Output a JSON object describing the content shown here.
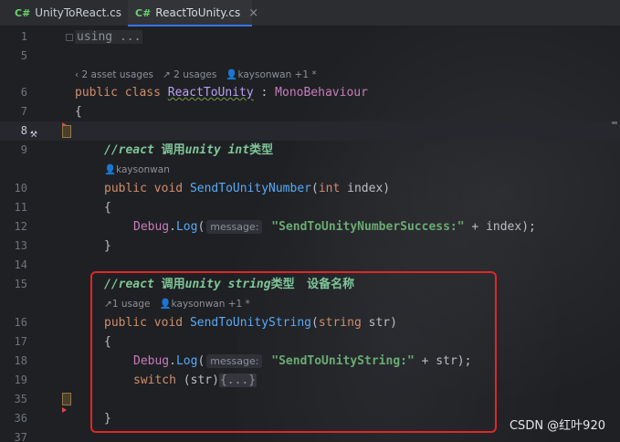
{
  "tabs": [
    {
      "badge": "C#",
      "label": "UnityToReact.cs"
    },
    {
      "badge": "C#",
      "label": "ReactToUnity.cs",
      "active": true
    }
  ],
  "tab_close": "×",
  "code": {
    "line1": {
      "num": "1",
      "fold": "using ..."
    },
    "line5": {
      "num": "5"
    },
    "hint_class": {
      "assets": "‹ 2 asset usages",
      "usages": "2 usages",
      "author": "kaysonwan +1 *"
    },
    "line6": {
      "num": "6",
      "kw1": "public",
      "kw2": "class",
      "name": "ReactToUnity",
      "colon": " : ",
      "base": "MonoBehaviour"
    },
    "line7": {
      "num": "7",
      "text": "{"
    },
    "line8": {
      "num": "8"
    },
    "line9": {
      "num": "9",
      "cmt_a": "//react ",
      "cmt_cn": "调用",
      "cmt_b": "unity int",
      "cmt_cn2": "类型"
    },
    "hint_m1": {
      "author": "kaysonwan"
    },
    "line10": {
      "num": "10",
      "kw1": "public",
      "kw2": "void",
      "name": "SendToUnityNumber",
      "open": "(",
      "ptype": "int",
      "rest": " index)"
    },
    "line11": {
      "num": "11",
      "text": "{"
    },
    "line12": {
      "num": "12",
      "cls": "Debug",
      "dot": ".",
      "call": "Log",
      "open": "(",
      "hint": "message:",
      "str": "\"SendToUnityNumberSuccess:\"",
      "rest": " + index);"
    },
    "line13": {
      "num": "13",
      "text": "}"
    },
    "line14": {
      "num": "14"
    },
    "line15": {
      "num": "15",
      "cmt_a": "//react ",
      "cmt_cn": "调用",
      "cmt_b": "unity string",
      "cmt_cn2": "类型   设备名称"
    },
    "hint_m2": {
      "usages": "1 usage",
      "author": "kaysonwan +1 *"
    },
    "line16": {
      "num": "16",
      "kw1": "public",
      "kw2": "void",
      "name": "SendToUnityString",
      "open": "(",
      "ptype": "string",
      "rest": " str)"
    },
    "line17": {
      "num": "17",
      "text": "{"
    },
    "line18": {
      "num": "18",
      "cls": "Debug",
      "dot": ".",
      "call": "Log",
      "open": "(",
      "hint": "message:",
      "str": "\"SendToUnityString:\"",
      "rest": " + str);"
    },
    "line19": {
      "num": "19",
      "kw": "switch",
      "rest": " (str)",
      "fold": "{...}"
    },
    "line35": {
      "num": "35"
    },
    "line36": {
      "num": "36",
      "text": "}"
    },
    "line37": {
      "num": "37"
    }
  },
  "watermark": "CSDN @红叶920"
}
